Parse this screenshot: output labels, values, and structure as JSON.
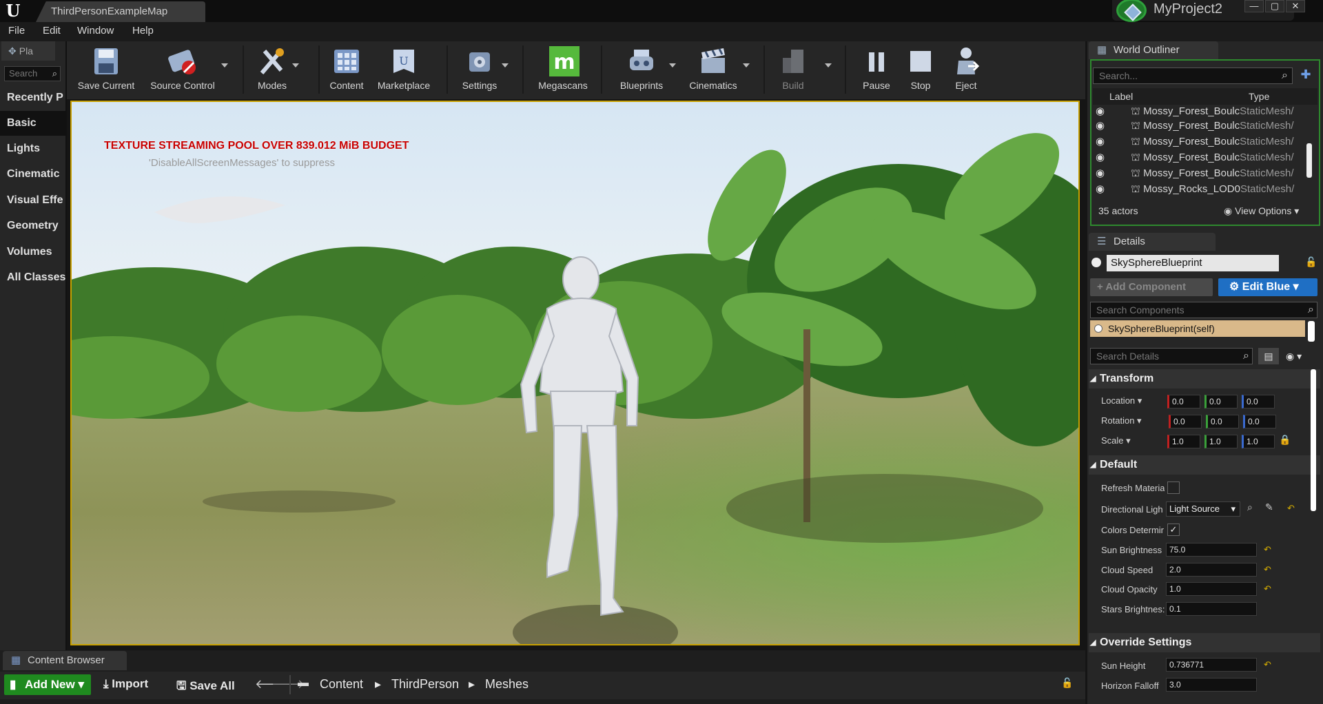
{
  "titlebar": {
    "map_tab": "ThirdPersonExampleMap",
    "project": "MyProject2",
    "win_min": "—",
    "win_max": "▢",
    "win_close": "✕"
  },
  "menu": [
    "File",
    "Edit",
    "Window",
    "Help"
  ],
  "place": {
    "tab_label": "Pla",
    "search_placeholder": "Search",
    "categories": [
      "Recently P",
      "Basic",
      "Lights",
      "Cinematic",
      "Visual Effe",
      "Geometry",
      "Volumes",
      "All Classes"
    ],
    "selected": "Basic"
  },
  "toolbar": {
    "items": [
      "Save Current",
      "Source Control",
      "Modes",
      "Content",
      "Marketplace",
      "Settings",
      "Megascans",
      "Blueprints",
      "Cinematics",
      "Build",
      "Pause",
      "Stop",
      "Eject"
    ]
  },
  "viewport": {
    "warning": "TEXTURE STREAMING POOL OVER 839.012 MiB BUDGET",
    "suppress": "'DisableAllScreenMessages' to suppress"
  },
  "outliner": {
    "tab": "World Outliner",
    "search_placeholder": "Search...",
    "col_label": "Label",
    "col_type": "Type",
    "rows": [
      {
        "label": "Mossy_Forest_Boulc",
        "type": "StaticMesh/"
      },
      {
        "label": "Mossy_Forest_Boulc",
        "type": "StaticMesh/"
      },
      {
        "label": "Mossy_Forest_Boulc",
        "type": "StaticMesh/"
      },
      {
        "label": "Mossy_Forest_Boulc",
        "type": "StaticMesh/"
      },
      {
        "label": "Mossy_Forest_Boulc",
        "type": "StaticMesh/"
      },
      {
        "label": "Mossy_Rocks_LOD0",
        "type": "StaticMesh/"
      }
    ],
    "actor_count": "35 actors",
    "view_options": "View Options"
  },
  "details": {
    "tab": "Details",
    "object_name": "SkySphereBlueprint",
    "add_component": "+ Add Component",
    "edit_blueprint": "Edit Blue",
    "search_components": "Search Components",
    "component_self": "SkySphereBlueprint(self)",
    "search_details": "Search Details",
    "transform": {
      "title": "Transform",
      "location_label": "Location",
      "rotation_label": "Rotation",
      "scale_label": "Scale",
      "location": [
        "0.0",
        "0.0",
        "0.0"
      ],
      "rotation": [
        "0.0",
        "0.0",
        "0.0"
      ],
      "scale": [
        "1.0",
        "1.0",
        "1.0"
      ]
    },
    "default": {
      "title": "Default",
      "refresh_material": "Refresh Materia",
      "directional_light": "Directional Ligh",
      "light_source": "Light Source",
      "colors_determined": "Colors Determir",
      "sun_brightness_label": "Sun Brightness",
      "sun_brightness": "75.0",
      "cloud_speed_label": "Cloud Speed",
      "cloud_speed": "2.0",
      "cloud_opacity_label": "Cloud Opacity",
      "cloud_opacity": "1.0",
      "stars_brightness_label": "Stars Brightnes:",
      "stars_brightness": "0.1",
      "colors_checked": true,
      "refresh_checked": false
    },
    "override": {
      "title": "Override Settings",
      "sun_height_label": "Sun Height",
      "sun_height": "0.736771",
      "horizon_falloff_label": "Horizon Falloff",
      "horizon_falloff": "3.0"
    }
  },
  "content_browser": {
    "tab": "Content Browser",
    "add_new": "Add New",
    "import": "Import",
    "save_all": "Save All",
    "path": [
      "Content",
      "ThirdPerson",
      "Meshes"
    ]
  },
  "colors": {
    "accent_green": "#1f8a1f",
    "edit_bp_blue": "#1f6fc4",
    "viewport_border": "#c8a000",
    "warning_red": "#c80000"
  }
}
